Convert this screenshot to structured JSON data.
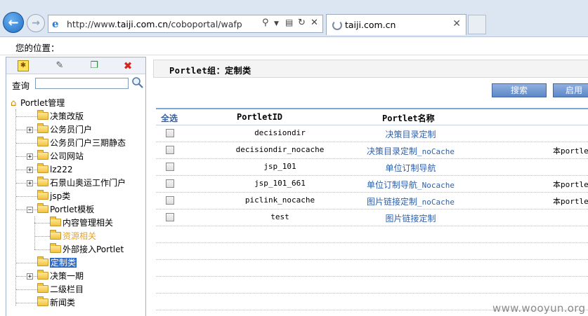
{
  "browser": {
    "url_prefix": "http://www.",
    "url_domain": "taiji.com.cn",
    "url_suffix": "/coboportal/wafplatform,",
    "tab_title": "taiji.com.cn"
  },
  "location_label": "您的位置：",
  "left_panel": {
    "search_label": "查询",
    "search_value": "",
    "tree": {
      "root": "Portlet管理",
      "items": [
        {
          "label": "决策改版",
          "expandable": false
        },
        {
          "label": "公务员门户",
          "expandable": true
        },
        {
          "label": "公务员门户三期静态",
          "expandable": false
        },
        {
          "label": "公司网站",
          "expandable": true
        },
        {
          "label": "lz222",
          "expandable": true
        },
        {
          "label": "石景山奥运工作门户",
          "expandable": true
        },
        {
          "label": "jsp类",
          "expandable": false
        },
        {
          "label": "Portlet模板",
          "expandable": true,
          "expanded": true
        },
        {
          "label": "内容管理相关",
          "expandable": false,
          "child": true
        },
        {
          "label": "资源相关",
          "expandable": false,
          "child": true,
          "highlight": true
        },
        {
          "label": "外部接入Portlet",
          "expandable": false,
          "child": true
        },
        {
          "label": "定制类",
          "expandable": false,
          "selected": true
        },
        {
          "label": "决策一期",
          "expandable": true
        },
        {
          "label": "二级栏目",
          "expandable": false
        },
        {
          "label": "新闻类",
          "expandable": false
        }
      ]
    }
  },
  "main": {
    "group_title": "Portlet组：定制类",
    "buttons": {
      "search": "搜索",
      "enable": "启用"
    },
    "table": {
      "headers": {
        "select_all": "全选",
        "id": "PortletID",
        "name": "Portlet名称"
      },
      "rows": [
        {
          "id": "decisiondir",
          "name": "决策目录定制",
          "name_suffix": "",
          "desc": ""
        },
        {
          "id": "decisiondir_nocache",
          "name": "决策目录定制",
          "name_suffix": "_noCache",
          "desc": "本portlet"
        },
        {
          "id": "jsp_101",
          "name": "单位订制导航",
          "name_suffix": "",
          "desc": ""
        },
        {
          "id": "jsp_101_661",
          "name": "单位订制导航",
          "name_suffix": "_Nocache",
          "desc": "本portlet"
        },
        {
          "id": "piclink_nocache",
          "name": "图片链接定制",
          "name_suffix": "_noCache",
          "desc": "本portlet"
        },
        {
          "id": "test",
          "name": "图片链接定制",
          "name_suffix": "",
          "desc": ""
        }
      ]
    }
  },
  "watermark": "www.wooyun.org",
  "colors": {
    "link": "#2f5fa8",
    "selected_bg": "#316ac5",
    "highlight": "#e9a320",
    "button": "#5d87c8"
  }
}
